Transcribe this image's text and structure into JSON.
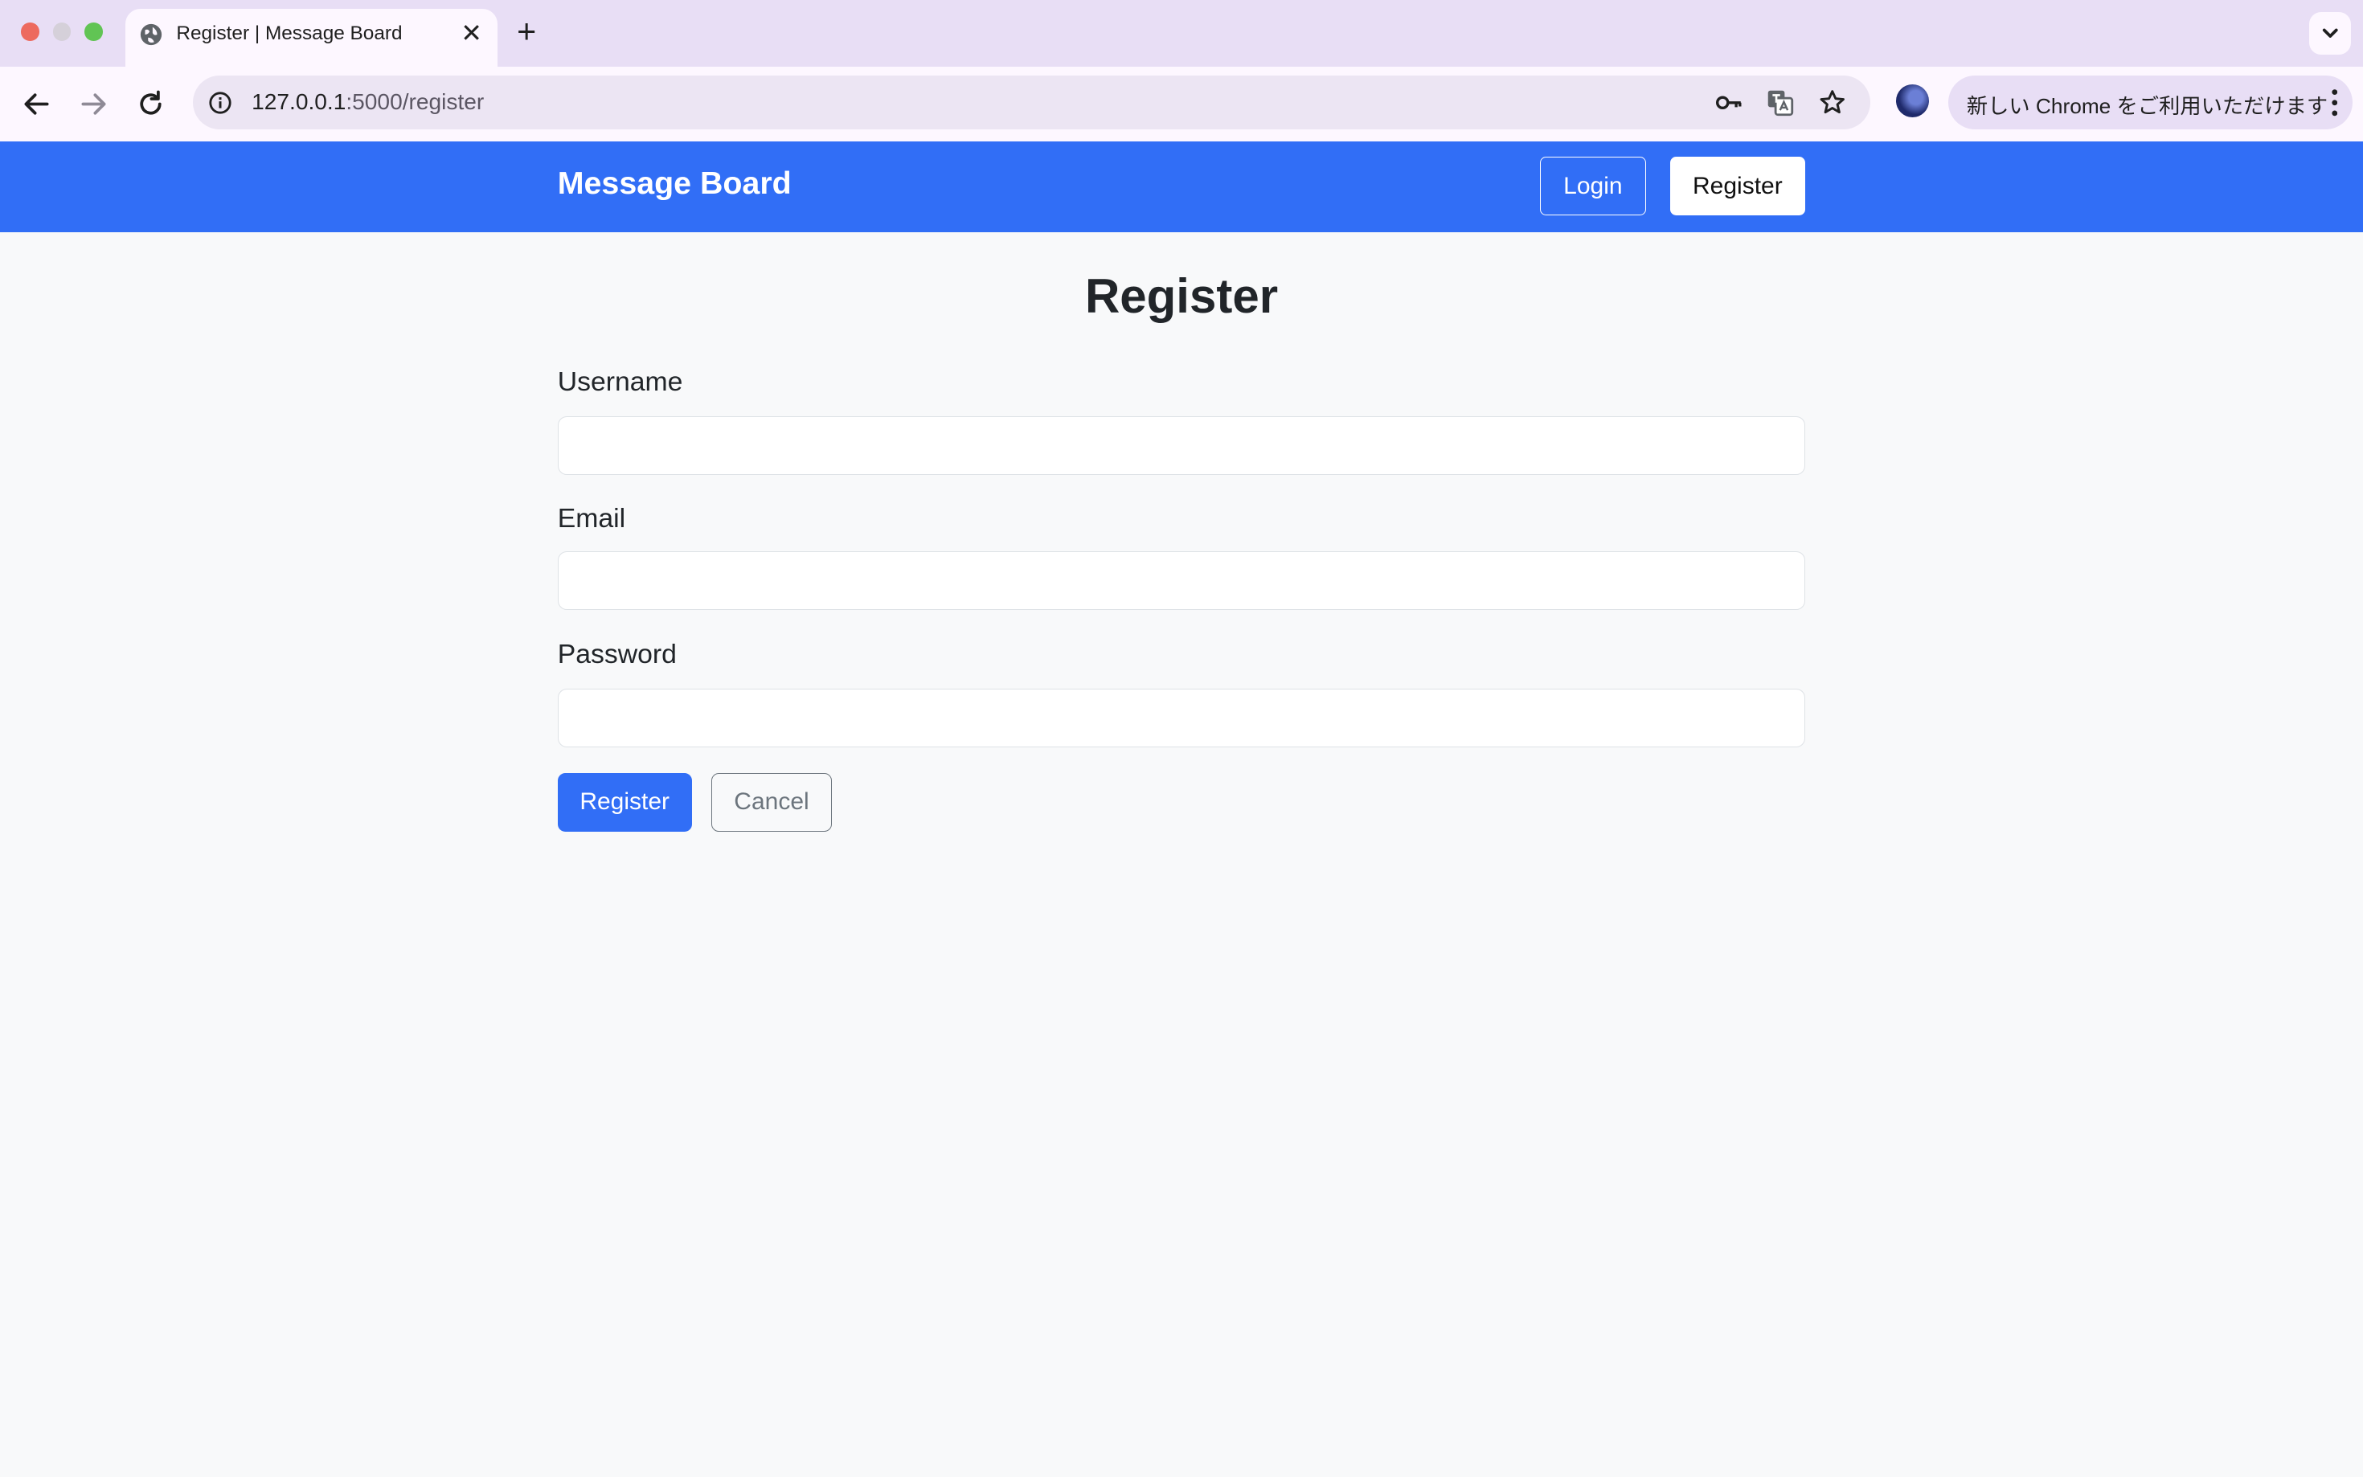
{
  "browser": {
    "tab_title": "Register | Message Board",
    "tab_close": "✕",
    "new_tab": "+",
    "url_host": "127.0.0.1",
    "url_path": ":5000/register",
    "update_text": "新しい Chrome をご利用いただけます"
  },
  "navbar": {
    "brand": "Message Board",
    "login_label": "Login",
    "register_label": "Register",
    "color": "#316ef6"
  },
  "form": {
    "title": "Register",
    "username_label": "Username",
    "username_value": "",
    "email_label": "Email",
    "email_value": "",
    "password_label": "Password",
    "password_value": "",
    "submit_label": "Register",
    "cancel_label": "Cancel"
  },
  "colors": {
    "accent": "#316ef6",
    "page_bg": "#f8f9fa",
    "tabstrip_bg": "#e8def5"
  },
  "icons": [
    "globe-icon",
    "close-icon",
    "plus-icon",
    "chevron-down-icon",
    "back-arrow-icon",
    "forward-arrow-icon",
    "reload-icon",
    "info-icon",
    "key-icon",
    "translate-icon",
    "star-icon",
    "avatar",
    "kebab-menu-icon"
  ]
}
